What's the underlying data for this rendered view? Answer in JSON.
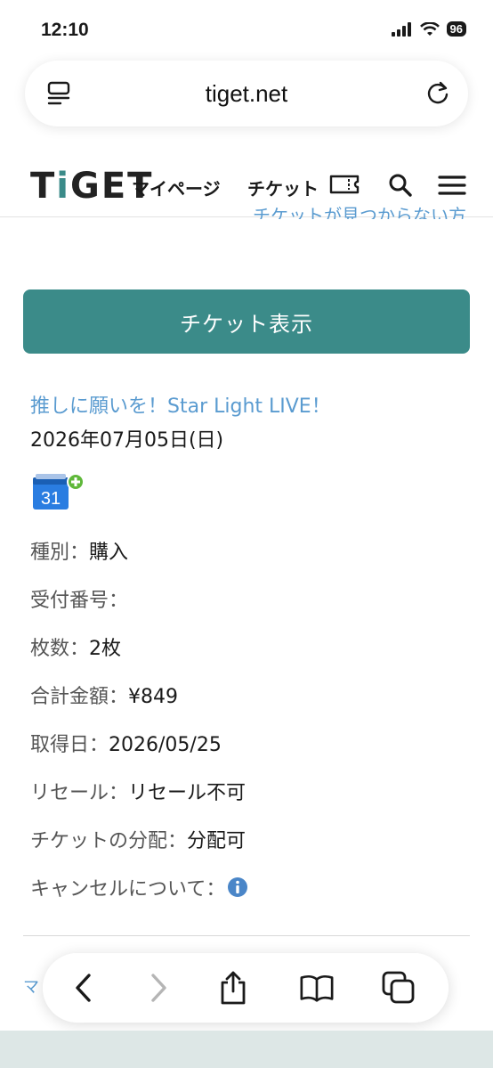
{
  "status": {
    "time": "12:10",
    "battery": "96"
  },
  "browser": {
    "url": "tiget.net"
  },
  "header": {
    "logo": "TiGET",
    "nav_mypage": "マイページ",
    "nav_ticket": "チケット"
  },
  "cut_link_text": "チケットが見つからない方",
  "ticket_button": "チケット表示",
  "event": {
    "title": "推しに願いを！Star Light LIVE！",
    "date": "2026年07月05日(日)",
    "calendar_day": "31"
  },
  "details": [
    {
      "label": "種別：",
      "value": "購入"
    },
    {
      "label": "受付番号：",
      "value": ""
    },
    {
      "label": "枚数：",
      "value": "2枚"
    },
    {
      "label": "合計金額：",
      "value": "¥849"
    },
    {
      "label": "取得日：",
      "value": "2026/05/25"
    },
    {
      "label": "リセール：",
      "value": "リセール不可"
    },
    {
      "label": "チケットの分配：",
      "value": "分配可"
    },
    {
      "label": "キャンセルについて：",
      "value": ""
    }
  ],
  "peek_text": "マ",
  "colors": {
    "accent": "#3b8b89",
    "link": "#5a9bd0",
    "info_icon": "#4a86c8"
  }
}
